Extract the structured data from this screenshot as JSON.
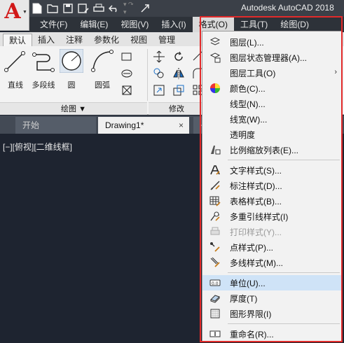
{
  "window": {
    "app_title": "Autodesk AutoCAD 2018",
    "logo_letter": "A",
    "logo_dropdown": "▼"
  },
  "quick_access": [
    "new-icon",
    "open-icon",
    "save-icon",
    "save-as-icon",
    "print-icon",
    "undo-icon",
    "redo-icon",
    "share-icon"
  ],
  "menubar": {
    "items": [
      {
        "label": "文件(F)"
      },
      {
        "label": "编辑(E)"
      },
      {
        "label": "视图(V)"
      },
      {
        "label": "插入(I)"
      },
      {
        "label": "格式(O)",
        "active": true
      },
      {
        "label": "工具(T)"
      },
      {
        "label": "绘图(D)"
      }
    ]
  },
  "ribbon": {
    "tabs": [
      {
        "label": "默认",
        "active": true
      },
      {
        "label": "插入"
      },
      {
        "label": "注释"
      },
      {
        "label": "参数化"
      },
      {
        "label": "视图"
      },
      {
        "label": "管理"
      }
    ],
    "draw_tools": [
      {
        "label": "直线"
      },
      {
        "label": "多段线"
      },
      {
        "label": "圆"
      },
      {
        "label": "圆弧"
      }
    ],
    "draw_panel_title": "绘图 ▼",
    "modify_panel_title": "修改"
  },
  "doc_tabs": {
    "start": "开始",
    "drawing": "Drawing1*",
    "close": "×",
    "add": "+"
  },
  "viewport": {
    "label": "[−][俯视][二维线框]"
  },
  "format_menu": {
    "items": [
      {
        "label": "图层(L)...",
        "icon": "layers-icon"
      },
      {
        "label": "图层状态管理器(A)...",
        "icon": "layer-states-icon"
      },
      {
        "label": "图层工具(O)",
        "icon": "",
        "submenu": true,
        "arrow": "›"
      },
      {
        "label": "颜色(C)...",
        "icon": "color-wheel-icon"
      },
      {
        "label": "线型(N)...",
        "icon": ""
      },
      {
        "label": "线宽(W)...",
        "icon": ""
      },
      {
        "label": "透明度",
        "icon": ""
      },
      {
        "label": "比例缩放列表(E)...",
        "icon": "scale-list-icon"
      },
      {
        "label": "文字样式(S)...",
        "icon": "text-style-icon"
      },
      {
        "label": "标注样式(D)...",
        "icon": "dim-style-icon"
      },
      {
        "label": "表格样式(B)...",
        "icon": "table-style-icon"
      },
      {
        "label": "多重引线样式(I)",
        "icon": "mleader-style-icon"
      },
      {
        "label": "打印样式(Y)...",
        "icon": "plot-style-icon",
        "disabled": true
      },
      {
        "label": "点样式(P)...",
        "icon": "point-style-icon"
      },
      {
        "label": "多线样式(M)...",
        "icon": "mline-style-icon"
      },
      {
        "label": "单位(U)...",
        "icon": "units-icon",
        "highlighted": true
      },
      {
        "label": "厚度(T)",
        "icon": "thickness-icon"
      },
      {
        "label": "图形界限(I)",
        "icon": "limits-icon"
      },
      {
        "label": "重命名(R)...",
        "icon": "rename-icon"
      }
    ]
  },
  "colors": {
    "highlight_frame": "#e22a2a",
    "menu_highlight": "#cfe3f7",
    "logo_red": "#d11818"
  }
}
